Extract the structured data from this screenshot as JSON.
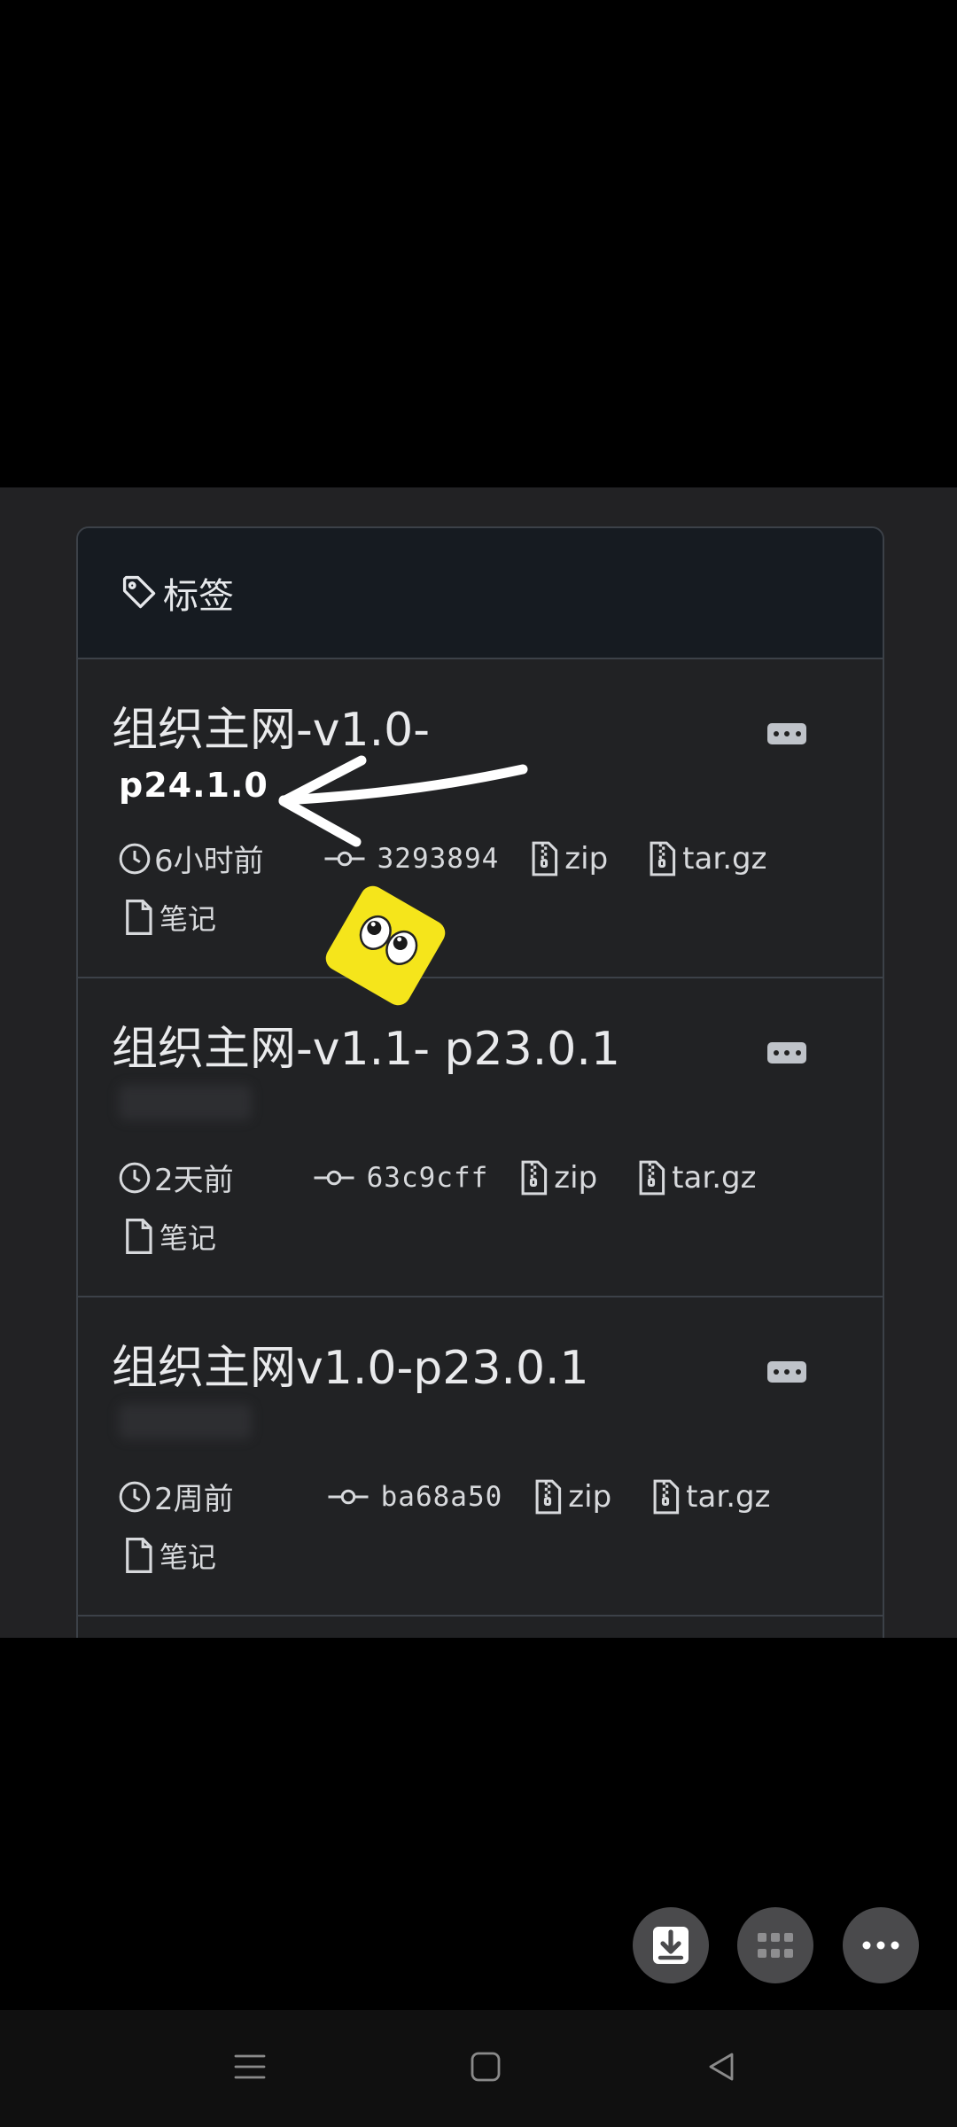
{
  "panel": {
    "header_label": "标签"
  },
  "releases": [
    {
      "title": "组织主网-v1.0-",
      "subtitle": "p24.1.0",
      "time": "6小时前",
      "commit": "3293894",
      "zip_label": "zip",
      "targz_label": "tar.gz",
      "note_label": "笔记"
    },
    {
      "title": "组织主网-v1.1- p23.0.1",
      "time": "2天前",
      "commit": "63c9cff",
      "zip_label": "zip",
      "targz_label": "tar.gz",
      "note_label": "笔记"
    },
    {
      "title": "组织主网v1.0-p23.0.1",
      "time": "2周前",
      "commit": "ba68a50",
      "zip_label": "zip",
      "targz_label": "tar.gz",
      "note_label": "笔记"
    }
  ],
  "icons": {
    "tag": "tag-icon",
    "clock": "clock-icon",
    "commit": "git-commit-icon",
    "archive": "file-zip-icon",
    "note": "file-icon",
    "more": "kebab-more-icon",
    "save": "download-icon",
    "grid": "grid-icon",
    "overflow": "more-horizontal-icon"
  },
  "colors": {
    "page_bg": "#000000",
    "panel_bg": "#212224",
    "header_bg": "#161b21",
    "border": "#3c4148",
    "text": "#e9eaec",
    "sticker": "#f5e51b"
  }
}
